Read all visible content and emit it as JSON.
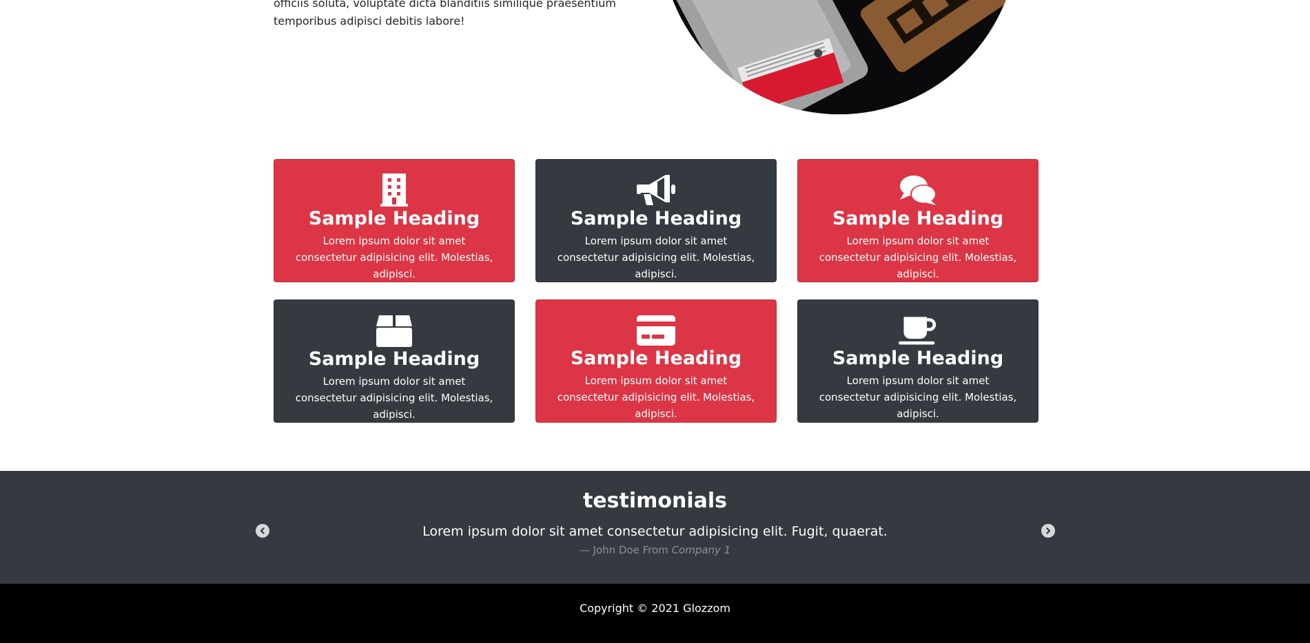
{
  "intro": {
    "text": "officiis soluta, voluptate dicta blanditiis similique praesentium temporibus adipisci debitis labore!"
  },
  "features": [
    {
      "icon": "building-icon",
      "color": "#dc3545",
      "heading": "Sample Heading",
      "text": "Lorem ipsum dolor sit amet consectetur adipisicing elit. Molestias, adipisci."
    },
    {
      "icon": "megaphone-icon",
      "color": "#343a40",
      "heading": "Sample Heading",
      "text": "Lorem ipsum dolor sit amet consectetur adipisicing elit. Molestias, adipisci."
    },
    {
      "icon": "comments-icon",
      "color": "#dc3545",
      "heading": "Sample Heading",
      "text": "Lorem ipsum dolor sit amet consectetur adipisicing elit. Molestias, adipisci."
    },
    {
      "icon": "box-icon",
      "color": "#343a40",
      "heading": "Sample Heading",
      "text": "Lorem ipsum dolor sit amet consectetur adipisicing elit. Molestias, adipisci."
    },
    {
      "icon": "credit-card-icon",
      "color": "#dc3545",
      "heading": "Sample Heading",
      "text": "Lorem ipsum dolor sit amet consectetur adipisicing elit. Molestias, adipisci."
    },
    {
      "icon": "coffee-icon",
      "color": "#343a40",
      "heading": "Sample Heading",
      "text": "Lorem ipsum dolor sit amet consectetur adipisicing elit. Molestias, adipisci."
    }
  ],
  "testimonials": {
    "title": "testimonials",
    "quote": "Lorem ipsum dolor sit amet consectetur adipisicing elit. Fugit, quaerat.",
    "author_prefix": "— John Doe From",
    "company": "Company 1",
    "prev_icon": "chevron-left-icon",
    "next_icon": "chevron-right-icon"
  },
  "footer": {
    "copyright": "Copyright © 2021 Glozzom"
  }
}
